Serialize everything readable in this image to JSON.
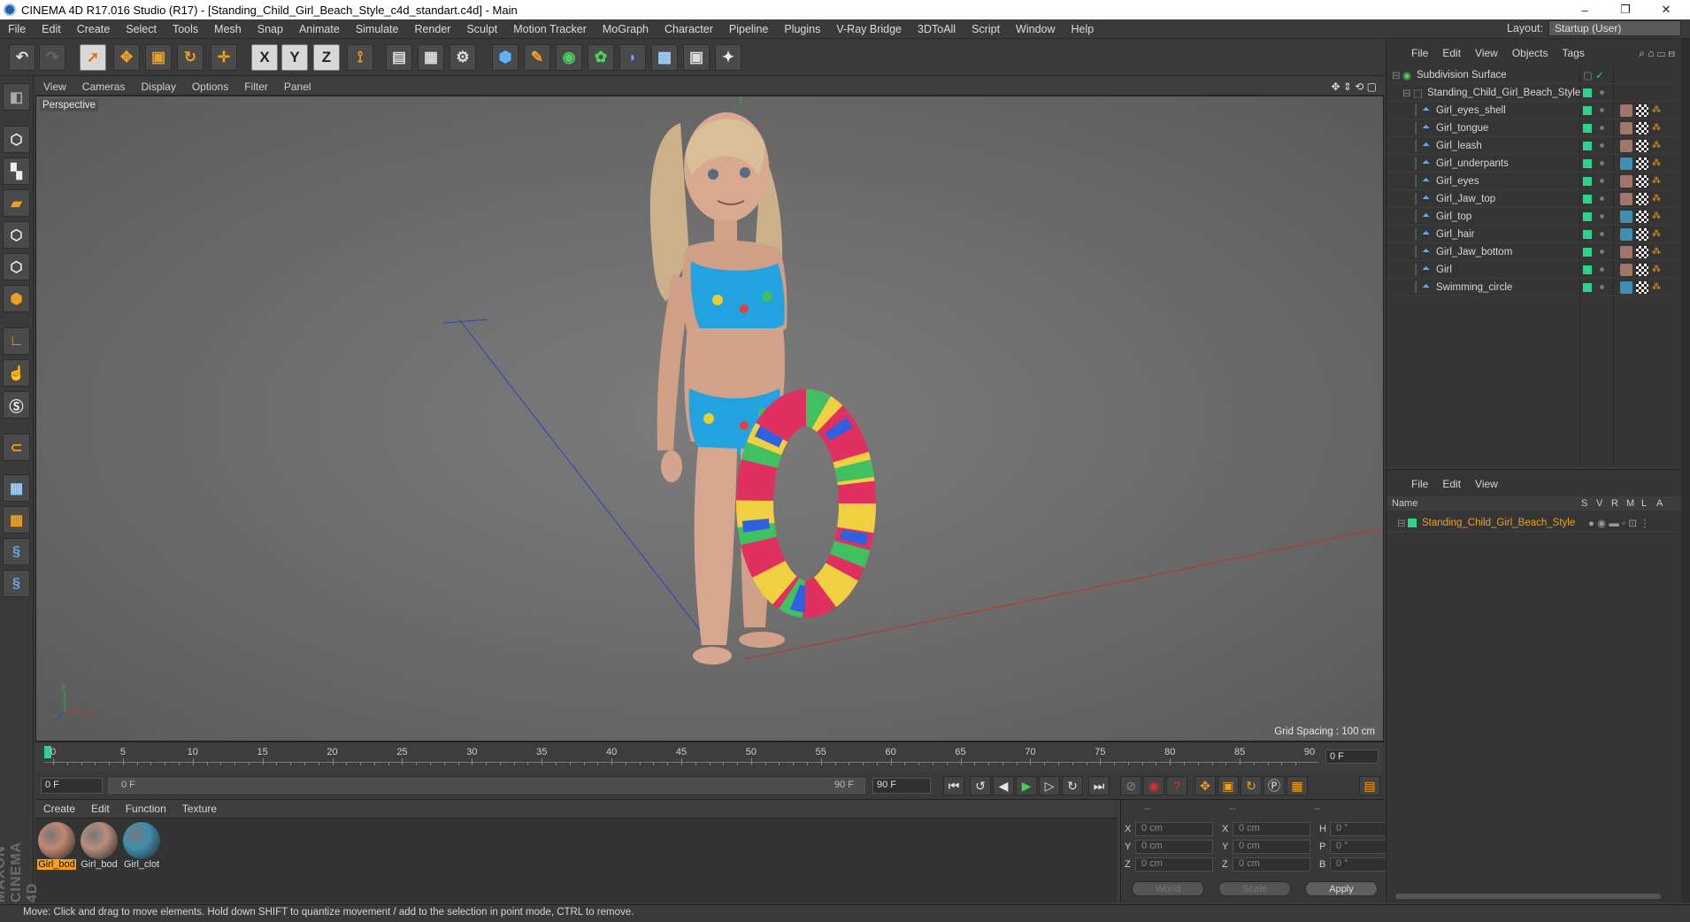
{
  "window": {
    "title": "CINEMA 4D R17.016 Studio (R17) - [Standing_Child_Girl_Beach_Style_c4d_standart.c4d] - Main",
    "minimize": "–",
    "restore": "❐",
    "close": "✕"
  },
  "menubar": {
    "items": [
      "File",
      "Edit",
      "Create",
      "Select",
      "Tools",
      "Mesh",
      "Snap",
      "Animate",
      "Simulate",
      "Render",
      "Sculpt",
      "Motion Tracker",
      "MoGraph",
      "Character",
      "Pipeline",
      "Plugins",
      "V-Ray Bridge",
      "3DToAll",
      "Script",
      "Window",
      "Help"
    ],
    "layout_label": "Layout:",
    "layout_value": "Startup (User)"
  },
  "toolbar": {
    "axis_x": "X",
    "axis_y": "Y",
    "axis_z": "Z"
  },
  "viewport": {
    "menu": [
      "View",
      "Cameras",
      "Display",
      "Options",
      "Filter",
      "Panel"
    ],
    "label": "Perspective",
    "grid_spacing": "Grid Spacing : 100 cm",
    "axis_x": "x",
    "axis_y": "y"
  },
  "timeline": {
    "ticks": [
      "0",
      "5",
      "10",
      "15",
      "20",
      "25",
      "30",
      "35",
      "40",
      "45",
      "50",
      "55",
      "60",
      "65",
      "70",
      "75",
      "80",
      "85",
      "90"
    ],
    "current_frame": "0 F"
  },
  "transport": {
    "start_field": "0 F",
    "range_start": "0 F",
    "range_end": "90 F",
    "end_field": "90 F"
  },
  "material_manager": {
    "menu": [
      "Create",
      "Edit",
      "Function",
      "Texture"
    ],
    "materials": [
      {
        "name": "Girl_bod",
        "color": "#c08870",
        "selected": true
      },
      {
        "name": "Girl_bod",
        "color": "#b88e7c",
        "selected": false
      },
      {
        "name": "Girl_clot",
        "color": "#3f8fb0",
        "selected": false
      }
    ]
  },
  "coordinates": {
    "header": [
      "--",
      "--",
      "--"
    ],
    "rows": [
      {
        "l1": "X",
        "v1": "0 cm",
        "l2": "X",
        "v2": "0 cm",
        "l3": "H",
        "v3": "0 °"
      },
      {
        "l1": "Y",
        "v1": "0 cm",
        "l2": "Y",
        "v2": "0 cm",
        "l3": "P",
        "v3": "0 °"
      },
      {
        "l1": "Z",
        "v1": "0 cm",
        "l2": "Z",
        "v2": "0 cm",
        "l3": "B",
        "v3": "0 °"
      }
    ],
    "world": "World",
    "scale": "Scale",
    "apply": "Apply"
  },
  "object_manager": {
    "menu": [
      "File",
      "Edit",
      "View",
      "Objects",
      "Tags"
    ],
    "root": "Subdivision Surface",
    "group": "Standing_Child_Girl_Beach_Style",
    "objects": [
      {
        "name": "Girl_eyes_shell",
        "tag_color": "#a0766a"
      },
      {
        "name": "Girl_tongue",
        "tag_color": "#a0766a"
      },
      {
        "name": "Girl_leash",
        "tag_color": "#a0766a"
      },
      {
        "name": "Girl_underpants",
        "tag_color": "#3f8fb0"
      },
      {
        "name": "Girl_eyes",
        "tag_color": "#a0766a"
      },
      {
        "name": "Girl_Jaw_top",
        "tag_color": "#a0766a"
      },
      {
        "name": "Girl_top",
        "tag_color": "#3f8fb0"
      },
      {
        "name": "Girl_hair",
        "tag_color": "#3f8fb0"
      },
      {
        "name": "Girl_Jaw_bottom",
        "tag_color": "#a0766a"
      },
      {
        "name": "Girl",
        "tag_color": "#a0766a"
      },
      {
        "name": "Swimming_circle",
        "tag_color": "#3f8fb0"
      }
    ]
  },
  "attribute_manager": {
    "menu": [
      "File",
      "Edit",
      "View"
    ],
    "columns": [
      "Name",
      "S",
      "V",
      "R",
      "M",
      "L",
      "A"
    ],
    "item": "Standing_Child_Girl_Beach_Style"
  },
  "statusbar": {
    "text": "Move: Click and drag to move elements. Hold down SHIFT to quantize movement / add to the selection in point mode, CTRL to remove."
  },
  "colors": {
    "accent_orange": "#f0a020",
    "accent_green": "#2bd48a",
    "bg_dark": "#3a3a3a",
    "x_axis": "#c03030",
    "z_axis": "#3040c0"
  }
}
